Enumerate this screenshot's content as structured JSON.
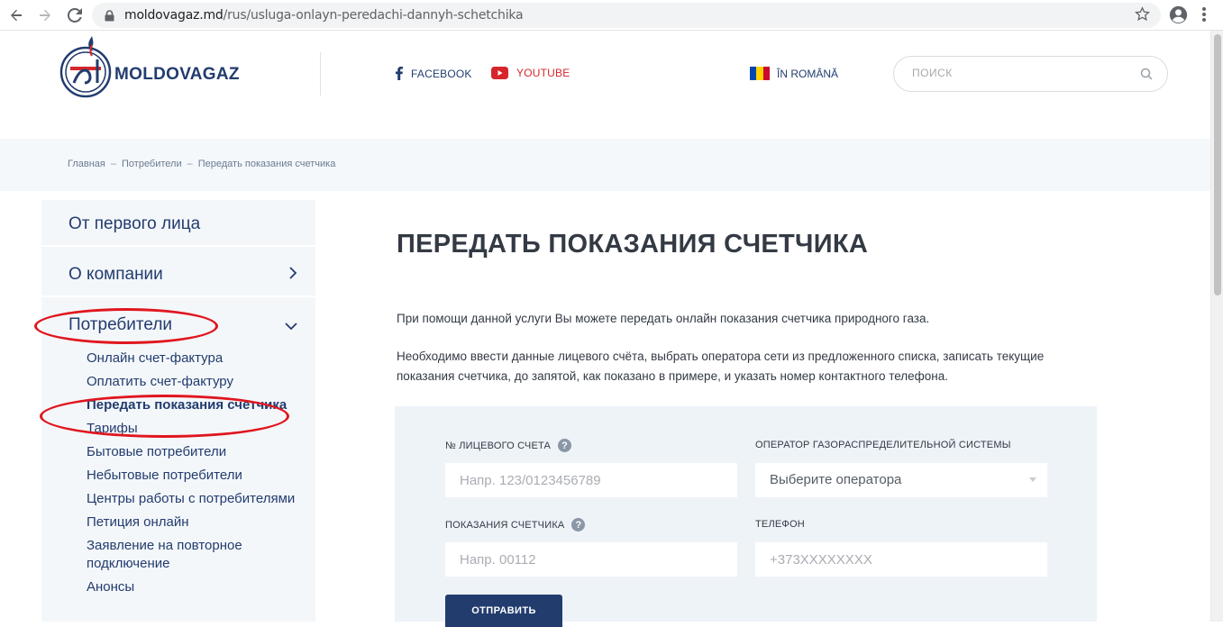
{
  "browser": {
    "url_domain": "moldovagaz.md",
    "url_path": "/rus/usluga-onlayn-peredachi-dannyh-schetchika"
  },
  "header": {
    "logo_text": "MOLDOVAGAZ",
    "facebook": "FACEBOOK",
    "youtube": "YOUTUBE",
    "language": "ÎN ROMÂNĂ",
    "search_placeholder": "ПОИСК"
  },
  "breadcrumb": {
    "home": "Главная",
    "section": "Потребители",
    "current": "Передать показания счетчика",
    "separator": "–"
  },
  "sidebar": {
    "items": [
      {
        "label": "От первого лица"
      },
      {
        "label": "О компании"
      },
      {
        "label": "Потребители"
      }
    ],
    "sub_items": [
      {
        "label": "Онлайн счет-фактура"
      },
      {
        "label": "Оплатить счет-фактуру"
      },
      {
        "label": "Передать показания счетчика"
      },
      {
        "label": "Тарифы"
      },
      {
        "label": "Бытовые потребители"
      },
      {
        "label": "Небытовые потребители"
      },
      {
        "label": "Центры работы с потребителями"
      },
      {
        "label": "Петиция онлайн"
      },
      {
        "label": "Заявление на повторное подключение"
      },
      {
        "label": "Анонсы"
      }
    ]
  },
  "main": {
    "title": "ПЕРЕДАТЬ ПОКАЗАНИЯ СЧЕТЧИКА",
    "intro": "При помощи данной услуги Вы можете передать онлайн показания счетчика природного газа.",
    "instructions": "Необходимо ввести данные лицевого счёта, выбрать оператора сети из предложенного списка, записать текущие показания счетчика, до запятой, как показано в примере, и указать номер контактного телефона."
  },
  "form": {
    "account_label": "№ ЛИЦЕВОГО СЧЕТА",
    "account_placeholder": "Напр. 123/0123456789",
    "operator_label": "ОПЕРАТОР ГАЗОРАСПРЕДЕЛИТЕЛЬНОЙ СИСТЕМЫ",
    "operator_selected": "Выберите оператора",
    "meter_label": "ПОКАЗАНИЯ СЧЕТЧИКА",
    "meter_placeholder": "Напр. 00112",
    "phone_label": "ТЕЛЕФОН",
    "phone_placeholder": "+373XXXXXXXX",
    "help_glyph": "?",
    "submit_label": "ОТПРАВИТЬ"
  },
  "colors": {
    "brand_navy": "#223c6e",
    "youtube_red": "#d6262c",
    "highlight_red": "#e0161e",
    "panel_bg": "#f4f7fa"
  }
}
